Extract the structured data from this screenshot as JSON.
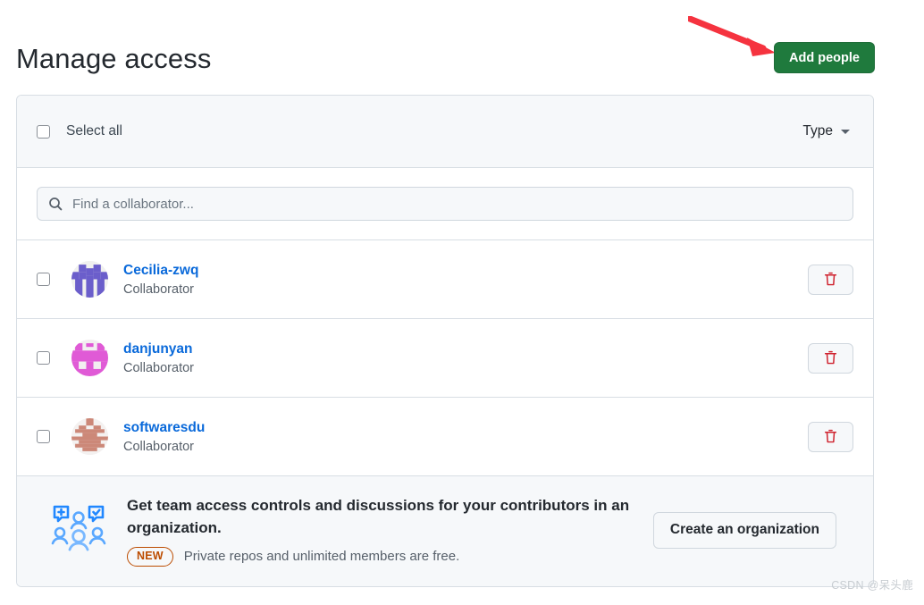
{
  "header": {
    "title": "Manage access",
    "add_people_label": "Add people",
    "add_people_color": "#1f7a3d",
    "annotation_arrow_color": "#f5333f"
  },
  "card": {
    "toolbar": {
      "select_all_label": "Select all",
      "type_filter_label": "Type",
      "chevron_icon": "chevron-down-icon"
    },
    "search": {
      "placeholder": "Find a collaborator...",
      "value": "",
      "icon": "search-icon"
    },
    "collaborators": [
      {
        "username": "Cecilia-zwq",
        "role": "Collaborator",
        "avatar_icon": "identicon-avatar",
        "avatar_color": "#6b5ecb",
        "avatar_bg": "#f0f0ef",
        "delete_icon": "trash-icon",
        "selected": false
      },
      {
        "username": "danjunyan",
        "role": "Collaborator",
        "avatar_icon": "identicon-avatar",
        "avatar_color": "#e05ad6",
        "avatar_bg": "#f2eff0",
        "delete_icon": "trash-icon",
        "selected": false
      },
      {
        "username": "softwaresdu",
        "role": "Collaborator",
        "avatar_icon": "identicon-avatar",
        "avatar_color": "#cc8878",
        "avatar_bg": "#f4f1f0",
        "delete_icon": "trash-icon",
        "selected": false
      }
    ],
    "org_promo": {
      "icon": "people-discussion-icon",
      "heading": "Get team access controls and discussions for your contributors in an organization.",
      "badge": "NEW",
      "badge_color": "#bc4c00",
      "subtext": "Private repos and unlimited members are free.",
      "button_label": "Create an organization"
    }
  },
  "watermark": "CSDN @呆头鹿",
  "link_color": "#0969da"
}
